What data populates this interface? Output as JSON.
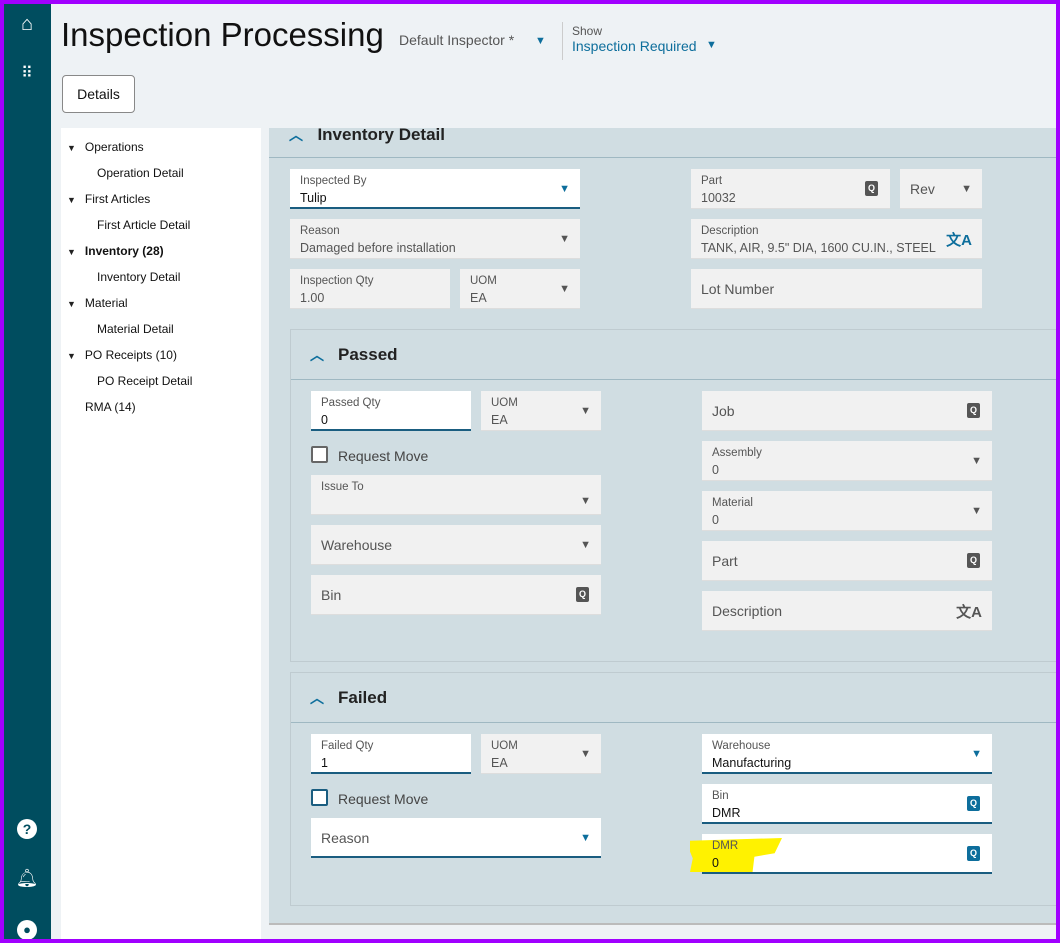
{
  "app": {
    "title": "Inspection Processing",
    "inspector": "Default Inspector *",
    "show_label": "Show",
    "show_value": "Inspection Required",
    "details_button": "Details"
  },
  "rail": {
    "icons": [
      "home-icon",
      "apps-grid-icon",
      "help-icon",
      "bell-icon",
      "user-icon"
    ]
  },
  "tree": [
    {
      "label": "Operations",
      "expanded": true
    },
    {
      "label": "Operation Detail"
    },
    {
      "label": "First Articles",
      "expanded": true
    },
    {
      "label": "First Article Detail"
    },
    {
      "label": "Inventory (28)",
      "expanded": true,
      "selected": true
    },
    {
      "label": "Inventory Detail"
    },
    {
      "label": "Material",
      "expanded": true
    },
    {
      "label": "Material Detail"
    },
    {
      "label": "PO Receipts (10)",
      "expanded": true
    },
    {
      "label": "PO Receipt Detail"
    },
    {
      "label": "RMA (14)"
    }
  ],
  "inventory": {
    "title": "Inventory Detail",
    "inspected_by": {
      "label": "Inspected By",
      "value": "Tulip"
    },
    "reason": {
      "label": "Reason",
      "value": "Damaged before installation"
    },
    "inspection_qty": {
      "label": "Inspection Qty",
      "value": "1.00"
    },
    "uom": {
      "label": "UOM",
      "value": "EA"
    },
    "part": {
      "label": "Part",
      "value": "10032"
    },
    "rev": {
      "label": "Rev"
    },
    "description": {
      "label": "Description",
      "value": "TANK, AIR, 9.5\" DIA, 1600 CU.IN., STEEL"
    },
    "lot": {
      "label": "Lot Number"
    }
  },
  "passed": {
    "title": "Passed",
    "qty": {
      "label": "Passed Qty",
      "value": "0"
    },
    "uom": {
      "label": "UOM",
      "value": "EA"
    },
    "request_move": "Request Move",
    "issue_to": {
      "label": "Issue To"
    },
    "warehouse": {
      "label": "Warehouse"
    },
    "bin": {
      "label": "Bin"
    },
    "job": {
      "label": "Job"
    },
    "assembly": {
      "label": "Assembly",
      "value": "0"
    },
    "material": {
      "label": "Material",
      "value": "0"
    },
    "part": {
      "label": "Part"
    },
    "description": {
      "label": "Description"
    }
  },
  "failed": {
    "title": "Failed",
    "qty": {
      "label": "Failed Qty",
      "value": "1"
    },
    "uom": {
      "label": "UOM",
      "value": "EA"
    },
    "request_move": "Request Move",
    "reason": {
      "label": "Reason"
    },
    "warehouse": {
      "label": "Warehouse",
      "value": "Manufacturing"
    },
    "bin": {
      "label": "Bin",
      "value": "DMR"
    },
    "dmr": {
      "label": "DMR",
      "value": "0"
    }
  },
  "colors": {
    "rail": "#004d5f",
    "accent": "#0d6e9c",
    "frame": "#a100ff",
    "highlight": "#fff200"
  }
}
